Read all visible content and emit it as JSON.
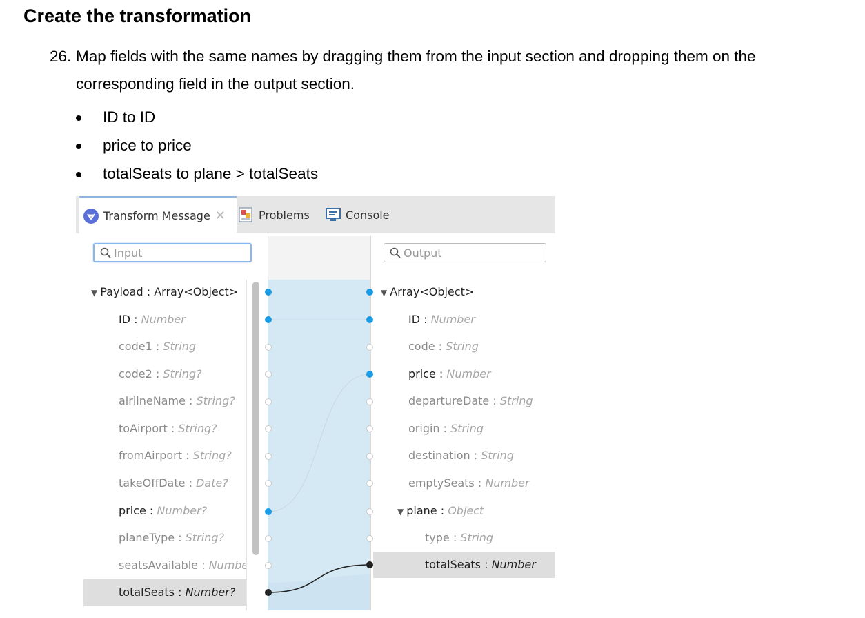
{
  "doc": {
    "heading": "Create the transformation",
    "step_number": "26.",
    "step_text": "Map fields with the same names by dragging them from the input section and dropping them on the corresponding field in the output section.",
    "bullets": [
      "ID to ID",
      "price to price",
      "totalSeats to plane > totalSeats"
    ]
  },
  "tabs": {
    "transform": "Transform Message",
    "problems": "Problems",
    "console": "Console"
  },
  "search": {
    "input_placeholder": "Input",
    "output_placeholder": "Output"
  },
  "input_tree": {
    "root": "Payload : Array<Object>",
    "fields": [
      {
        "name": "ID",
        "type": "Number"
      },
      {
        "name": "code1",
        "type": "String"
      },
      {
        "name": "code2",
        "type": "String?"
      },
      {
        "name": "airlineName",
        "type": "String?"
      },
      {
        "name": "toAirport",
        "type": "String?"
      },
      {
        "name": "fromAirport",
        "type": "String?"
      },
      {
        "name": "takeOffDate",
        "type": "Date?"
      },
      {
        "name": "price",
        "type": "Number?"
      },
      {
        "name": "planeType",
        "type": "String?"
      },
      {
        "name": "seatsAvailable",
        "type": "Numbe"
      },
      {
        "name": "totalSeats",
        "type": "Number?"
      }
    ]
  },
  "output_tree": {
    "root": "Array<Object>",
    "fields": [
      {
        "name": "ID",
        "type": "Number"
      },
      {
        "name": "code",
        "type": "String"
      },
      {
        "name": "price",
        "type": "Number"
      },
      {
        "name": "departureDate",
        "type": "String"
      },
      {
        "name": "origin",
        "type": "String"
      },
      {
        "name": "destination",
        "type": "String"
      },
      {
        "name": "emptySeats",
        "type": "Number"
      },
      {
        "name": "plane",
        "type": "Object"
      },
      {
        "name": "type",
        "type": "String"
      },
      {
        "name": "totalSeats",
        "type": "Number"
      }
    ]
  },
  "colors": {
    "accent": "#1a9be6",
    "mapping_area": "#d5e9f5",
    "selected_row": "#dedede"
  }
}
